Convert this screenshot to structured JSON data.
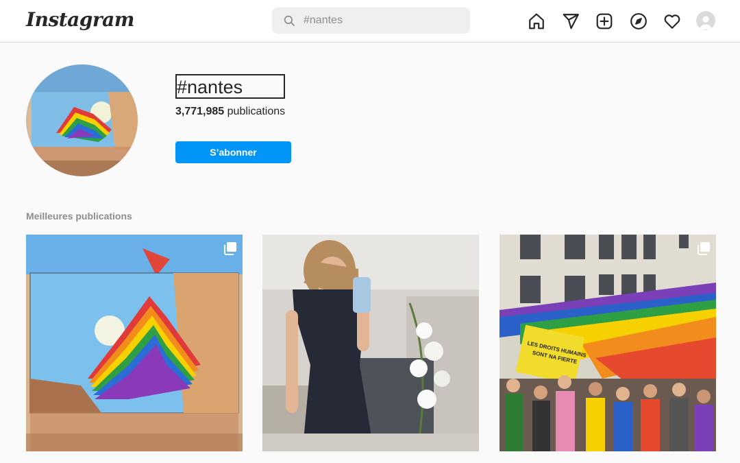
{
  "nav": {
    "logo": "Instagram",
    "search_placeholder": "#nantes"
  },
  "header": {
    "hashtag": "#nantes",
    "post_count": "3,771,985",
    "post_count_label": "publications",
    "follow_label": "S’abonner"
  },
  "top_posts": {
    "title": "Meilleures publications"
  },
  "colors": {
    "accent": "#0095f6",
    "background": "#fafafa",
    "border": "#dbdbdb"
  }
}
